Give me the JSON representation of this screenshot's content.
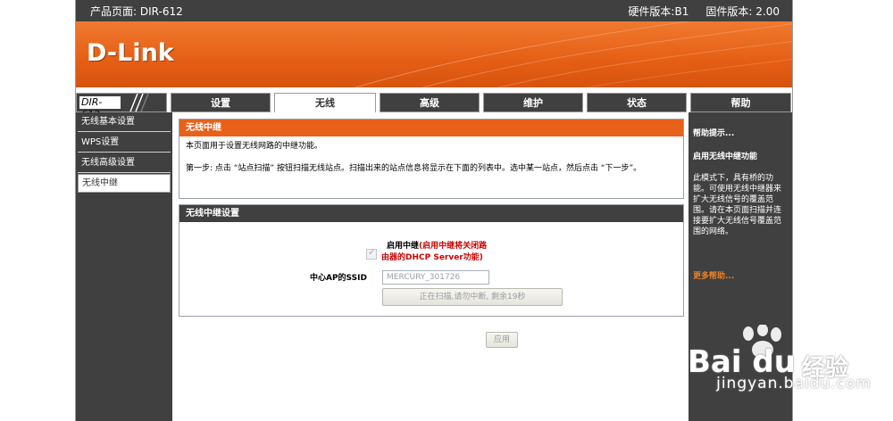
{
  "header": {
    "product_label": "产品页面: DIR-612",
    "hardware_version": "硬件版本:B1",
    "firmware_version": "固件版本: 2.00",
    "logo": "D-Link",
    "model": "DIR-612"
  },
  "tabs": [
    {
      "label": "设置",
      "active": false
    },
    {
      "label": "无线",
      "active": true
    },
    {
      "label": "高级",
      "active": false
    },
    {
      "label": "维护",
      "active": false
    },
    {
      "label": "状态",
      "active": false
    },
    {
      "label": "帮助",
      "active": false
    }
  ],
  "sidebar": {
    "items": [
      {
        "label": "无线基本设置",
        "active": false
      },
      {
        "label": "WPS设置",
        "active": false
      },
      {
        "label": "无线高级设置",
        "active": false
      },
      {
        "label": "无线中继",
        "active": true
      }
    ]
  },
  "intro_box": {
    "title": "无线中继",
    "description": "本页面用于设置无线网路的中继功能。",
    "step": "第一步: 点击 “站点扫描” 按钮扫描无线站点。扫描出来的站点信息将显示在下面的列表中。选中某一站点，然后点击 “下一步”。"
  },
  "settings_box": {
    "title": "无线中继设置",
    "enable_label": "启用中继",
    "enable_note_line1": "(启用中继将关闭路",
    "enable_note_line2": "由器的DHCP Server功能)",
    "enable_checked": true,
    "ssid_label": "中心AP的SSID",
    "ssid_placeholder": "MERCURY_301726",
    "scan_status": "正在扫描,请勿中断, 剩余19秒"
  },
  "apply_label": "应用",
  "help": {
    "title": "帮助提示...",
    "subtitle": "启用无线中继功能",
    "body": "此模式下，具有桥的功能。可使用无线中继器来扩大无线信号的覆盖范围。请在本页面扫描并连接要扩大无线信号覆盖范围的网络。",
    "more": "更多帮助..."
  },
  "watermark": {
    "logo": "Bai du",
    "cn": "经验",
    "url": "jingyan.baidu.com"
  },
  "colors": {
    "accent": "#e8611a",
    "dark": "#404040",
    "warning": "#cc0000"
  }
}
